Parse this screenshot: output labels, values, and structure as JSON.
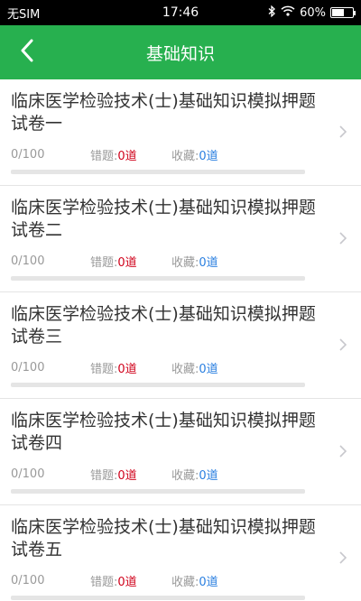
{
  "status_bar": {
    "carrier": "无SIM",
    "time": "17:46",
    "battery_percent": "60%",
    "battery_level": 0.6,
    "icons": [
      "bluetooth-icon",
      "wifi-icon",
      "battery-icon"
    ]
  },
  "nav": {
    "title": "基础知识",
    "back_icon": "chevron-left-icon"
  },
  "colors": {
    "accent": "#27b04f",
    "wrong": "#d0021b",
    "fav": "#2a7fe0"
  },
  "papers": [
    {
      "title": "临床医学检验技术(士)基础知识模拟押题试卷一",
      "progress": "0/100",
      "progress_fraction": 0,
      "wrong_label": "错题:",
      "wrong_count": "0道",
      "fav_label": "收藏:",
      "fav_count": "0道"
    },
    {
      "title": "临床医学检验技术(士)基础知识模拟押题试卷二",
      "progress": "0/100",
      "progress_fraction": 0,
      "wrong_label": "错题:",
      "wrong_count": "0道",
      "fav_label": "收藏:",
      "fav_count": "0道"
    },
    {
      "title": "临床医学检验技术(士)基础知识模拟押题试卷三",
      "progress": "0/100",
      "progress_fraction": 0,
      "wrong_label": "错题:",
      "wrong_count": "0道",
      "fav_label": "收藏:",
      "fav_count": "0道"
    },
    {
      "title": "临床医学检验技术(士)基础知识模拟押题试卷四",
      "progress": "0/100",
      "progress_fraction": 0,
      "wrong_label": "错题:",
      "wrong_count": "0道",
      "fav_label": "收藏:",
      "fav_count": "0道"
    },
    {
      "title": "临床医学检验技术(士)基础知识模拟押题试卷五",
      "progress": "0/100",
      "progress_fraction": 0,
      "wrong_label": "错题:",
      "wrong_count": "0道",
      "fav_label": "收藏:",
      "fav_count": "0道"
    }
  ]
}
